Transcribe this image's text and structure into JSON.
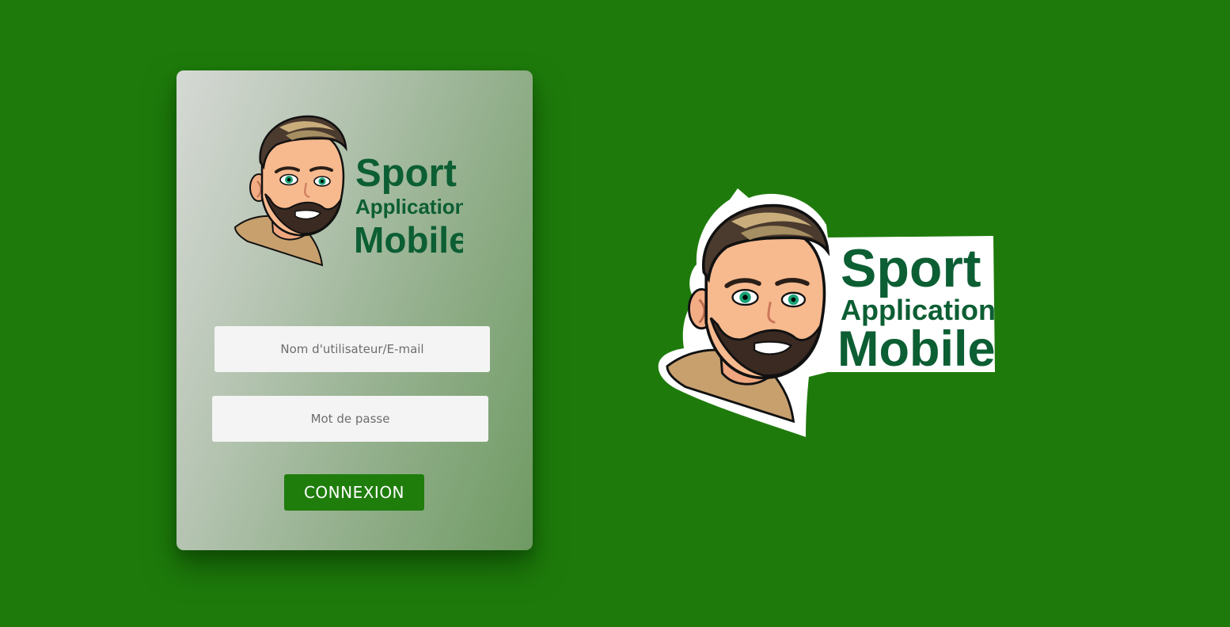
{
  "login": {
    "username_placeholder": "Nom d'utilisateur/E-mail",
    "password_placeholder": "Mot de passe",
    "submit_label": "CONNEXION"
  },
  "logo": {
    "line1": "Sport",
    "line2": "Application",
    "line3": "Mobile",
    "text_color": "#0c5e33",
    "icon": "bearded-man-avatar-icon"
  },
  "colors": {
    "background": "#1e7b0b",
    "button": "#1f7d0c"
  }
}
